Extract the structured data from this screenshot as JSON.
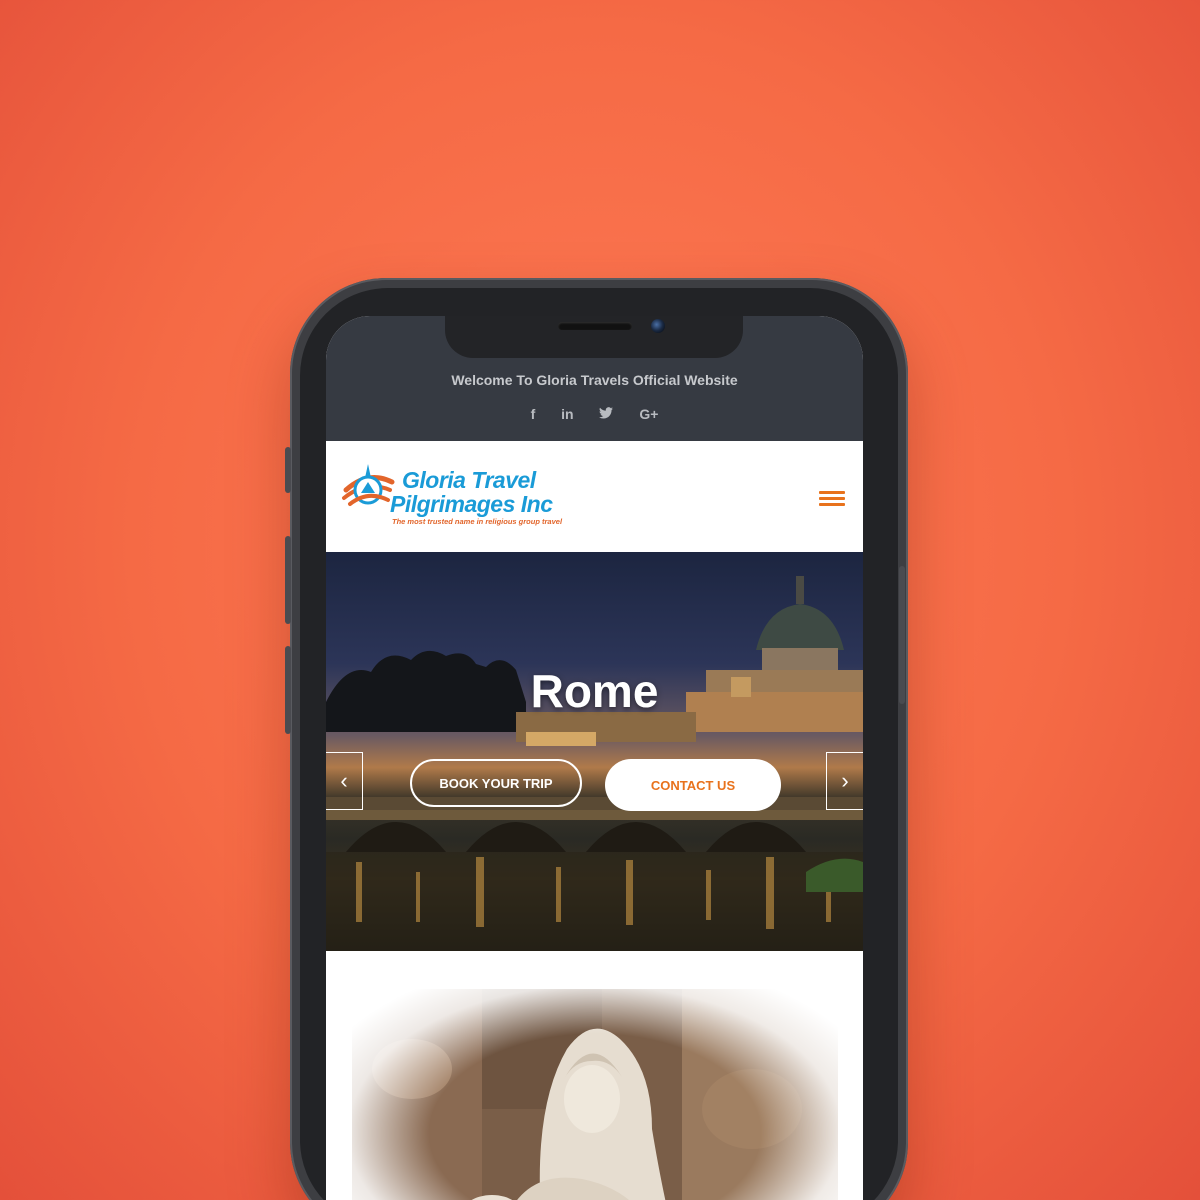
{
  "topbar": {
    "welcome": "Welcome To Gloria Travels Official Website",
    "social_icons": [
      {
        "name": "facebook-icon",
        "glyph": "f"
      },
      {
        "name": "linkedin-icon",
        "glyph": "in"
      },
      {
        "name": "twitter-icon",
        "glyph": "🐦"
      },
      {
        "name": "google-plus-icon",
        "glyph": "G+"
      }
    ]
  },
  "header": {
    "logo_line1": "Gloria Travel",
    "logo_line2": "Pilgrimages Inc",
    "logo_tagline": "The most trusted name in religious group travel",
    "menu_icon": "hamburger-menu-icon"
  },
  "hero": {
    "title": "Rome",
    "book_label": "BOOK YOUR TRIP",
    "contact_label": "CONTACT US",
    "prev_icon": "‹",
    "next_icon": "›"
  },
  "colors": {
    "background": "#f56a45",
    "topbar": "#363a42",
    "accent_orange": "#e8721c",
    "logo_blue": "#1a9bd7"
  }
}
